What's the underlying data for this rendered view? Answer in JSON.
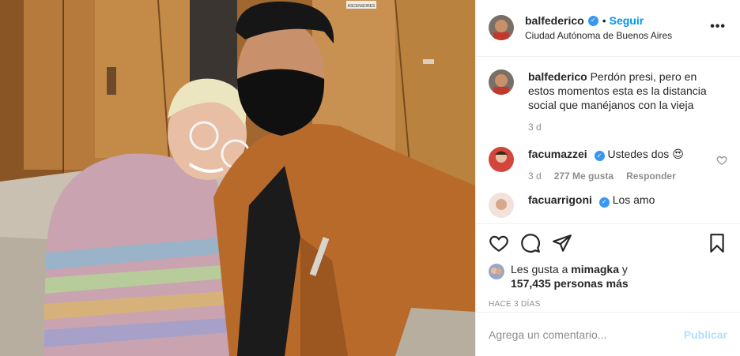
{
  "post": {
    "username": "balfederico",
    "follow_label": "Seguir",
    "location": "Ciudad Autónoma de Buenos Aires",
    "more_label": "•••"
  },
  "caption": {
    "username": "balfederico",
    "text": "Perdón presi, pero en estos momentos esta es la distancia social que manéjanos con la vieja",
    "time": "3 d"
  },
  "comments": [
    {
      "username": "facumazzei",
      "text": "Ustedes dos 😍",
      "time": "3 d",
      "likes": "277 Me gusta",
      "reply_label": "Responder"
    },
    {
      "username": "facuarrigoni",
      "text": "Los amo"
    }
  ],
  "likes": {
    "prefix": "Les gusta a",
    "user": "mimagka",
    "connector": "y",
    "count": "157,435 personas más"
  },
  "posted_ago": "HACE 3 DÍAS",
  "composer": {
    "placeholder": "Agrega un comentario...",
    "publish_label": "Publicar"
  },
  "photo_sign": "ASCENSORES",
  "colors": {
    "accent": "#0095f6",
    "verified": "#3897f0",
    "publish_disabled": "#b2dffc"
  }
}
